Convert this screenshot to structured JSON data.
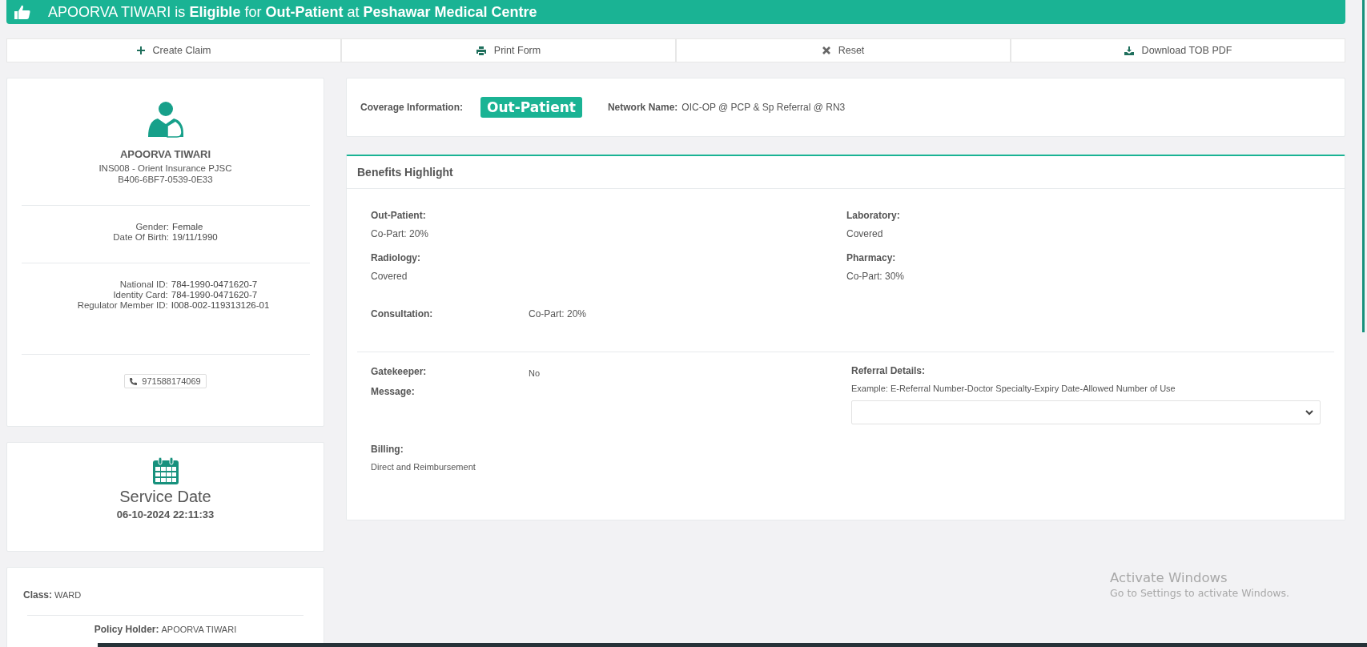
{
  "banner": {
    "text": "APOORVA TIWARI is **Eligible** for **Out-Patient** at **Peshawar Medical Centre**"
  },
  "actions": [
    {
      "label": "Create Claim",
      "kind": "plus"
    },
    {
      "label": "Print Form",
      "kind": "print"
    },
    {
      "label": "Reset",
      "kind": "reset"
    },
    {
      "label": "Download TOB PDF",
      "kind": "download"
    }
  ],
  "member": {
    "name": "APOORVA TIWARI",
    "insurer": "INS008 - Orient Insurance PJSC",
    "card_number": "B406-6BF7-0539-0E33",
    "personal": [
      {
        "label": "Gender:",
        "value": "Female"
      },
      {
        "label": "Date Of Birth:",
        "value": "19/11/1990"
      }
    ],
    "ids": [
      {
        "label": "National ID:",
        "value": "784-1990-0471620-7"
      },
      {
        "label": "Identity Card:",
        "value": "784-1990-0471620-7"
      },
      {
        "label": "Regulator Member ID:",
        "value": "I008-002-119313126-01"
      }
    ],
    "phone": "971588174069"
  },
  "service": {
    "title": "Service Date",
    "datetime": "06-10-2024 22:11:33"
  },
  "policy": [
    {
      "label": "Class:",
      "value": "WARD"
    },
    {
      "label": "Policy Holder:",
      "value": "APOORVA TIWARI"
    }
  ],
  "coverage": {
    "label": "Coverage Information:",
    "badge": "Out-Patient",
    "network_label": "Network Name:",
    "network": "OIC-OP @ PCP & Sp Referral @ RN3"
  },
  "benefits": {
    "title": "Benefits Highlight",
    "items": [
      {
        "label": "Out-Patient:",
        "value": "Co-Part: 20%"
      },
      {
        "label": "Laboratory:",
        "value": "Covered"
      },
      {
        "label": "Radiology:",
        "value": "Covered"
      },
      {
        "label": "Pharmacy:",
        "value": "Co-Part: 30%"
      }
    ],
    "consultation": {
      "label": "Consultation:",
      "value": "Co-Part: 20%"
    },
    "gatekeeper": {
      "label": "Gatekeeper:",
      "value": "No"
    },
    "message": {
      "label": "Message:"
    },
    "referral": {
      "label": "Referral Details:",
      "hint": "Example: E-Referral Number-Doctor Specialty-Expiry Date-Allowed Number of Use"
    },
    "billing": {
      "label": "Billing:",
      "value": "Direct and Reimbursement"
    }
  },
  "os_notice": {
    "title": "Activate Windows",
    "text": "Go to Settings to activate Windows."
  }
}
